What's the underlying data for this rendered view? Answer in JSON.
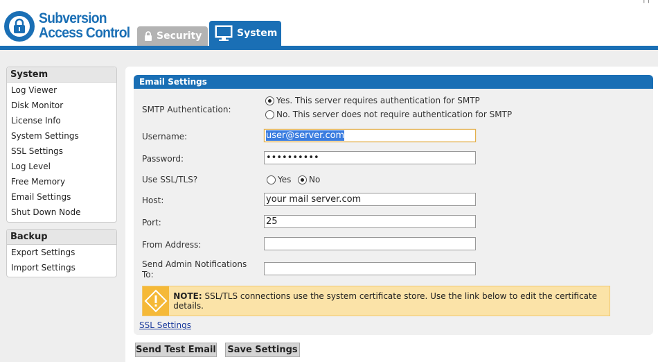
{
  "app": {
    "logo_line1": "Subversion",
    "logo_line2": "Access Control",
    "top_links": "| |",
    "tabs": [
      {
        "label": "Security",
        "icon": "lock-icon",
        "active": false
      },
      {
        "label": "System",
        "icon": "monitor-icon",
        "active": true
      }
    ]
  },
  "sidebar": {
    "system": {
      "title": "System",
      "items": [
        "Log Viewer",
        "Disk Monitor",
        "License Info",
        "System Settings",
        "SSL Settings",
        "Log Level",
        "Free Memory",
        "Email Settings",
        "Shut Down Node"
      ]
    },
    "backup": {
      "title": "Backup",
      "items": [
        "Export Settings",
        "Import Settings"
      ]
    }
  },
  "email": {
    "panel_title": "Email Settings",
    "smtp_auth_label": "SMTP Authentication:",
    "smtp_auth_yes": "Yes. This server requires authentication for SMTP",
    "smtp_auth_no": "No. This server does not require authentication for SMTP",
    "smtp_auth_value": "yes",
    "username_label": "Username:",
    "username_value": "user@server.com",
    "password_label": "Password:",
    "password_value": "••••••••••",
    "ssl_label": "Use SSL/TLS?",
    "ssl_yes": "Yes",
    "ssl_no": "No",
    "ssl_value": "no",
    "host_label": "Host:",
    "host_value": "your mail server.com",
    "port_label": "Port:",
    "port_value": "25",
    "from_label": "From Address:",
    "from_value": "",
    "notify_label_1": "Send Admin Notifications",
    "notify_label_2": "To:",
    "notify_value": "",
    "note_prefix": "NOTE:",
    "note_text": "SSL/TLS connections use the system certificate store. Use the link below to edit the certificate details.",
    "ssl_link": "SSL Settings",
    "send_test_button": "Send Test Email",
    "save_button": "Save Settings"
  },
  "colors": {
    "brand_blue": "#1a6fb5",
    "warning": "#f5b938"
  }
}
